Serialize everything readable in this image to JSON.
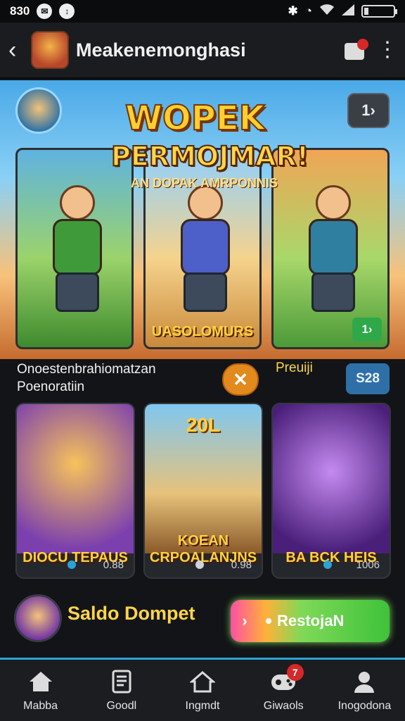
{
  "status_bar": {
    "time": "830",
    "icons": [
      "message-icon",
      "data-icon",
      "bluetooth-icon",
      "alarm-icon",
      "wifi-icon",
      "signal-icon",
      "battery-icon"
    ]
  },
  "app_bar": {
    "title": "Meakenemonghasi",
    "back_icon": "‹",
    "more_icon": "⋮"
  },
  "banner": {
    "title": "WOPEK",
    "subtitle": "PERMOJMAR!",
    "tagline": "AN DOPAK AMRPONNIS",
    "next_label": "1›",
    "cards": [
      {
        "label": ""
      },
      {
        "label": "UASOLOMURS"
      },
      {
        "label": "",
        "next_label": "1›"
      }
    ]
  },
  "info_row": {
    "text_line1": "Onoestenbrahiomatzan",
    "text_line2": "Poenoratiin",
    "close_icon": "✕",
    "tag": "Preuiji",
    "value": "S28"
  },
  "games": [
    {
      "year": "",
      "title": "DIOCU TEPAUS",
      "stat": "0.88",
      "dot_color": "#2aa3d6"
    },
    {
      "year": "20L",
      "title": "KOEAN CRPOALANJNS",
      "stat": "0.98",
      "dot_color": "#cfd3d8"
    },
    {
      "year": "",
      "title": "BA BCK HEIS",
      "stat": "1006",
      "dot_color": "#2aa3d6"
    }
  ],
  "wallet": {
    "label": "Saldo Dompet",
    "cta_label": "RestojaN",
    "cta_chevron": "›"
  },
  "bottom_nav": [
    {
      "label": "Mabba",
      "icon": "home-icon"
    },
    {
      "label": "Goodl",
      "icon": "document-icon"
    },
    {
      "label": "Ingmdt",
      "icon": "house-outline-icon"
    },
    {
      "label": "Giwaols",
      "icon": "gamepad-icon",
      "badge": "7"
    },
    {
      "label": "Inogodona",
      "icon": "person-icon"
    }
  ]
}
